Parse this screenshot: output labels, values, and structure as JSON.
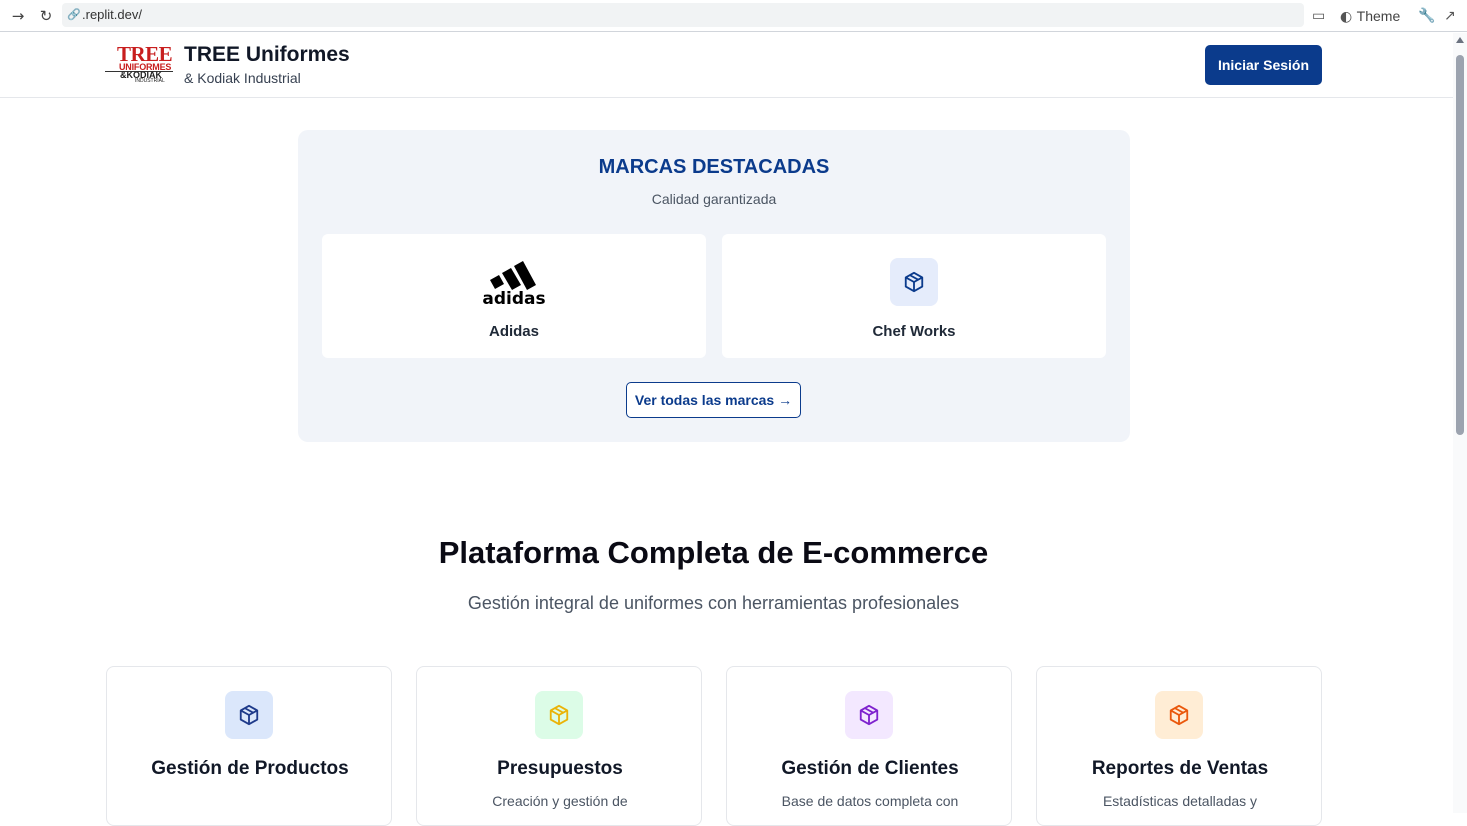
{
  "browser": {
    "url": ".replit.dev/",
    "theme_label": "Theme"
  },
  "header": {
    "logo": {
      "line1": "TREE",
      "line2": "UNIFORMES",
      "line3": "&KODIAK",
      "line4": "INDUSTRIAL"
    },
    "brand_name": "TREE Uniformes",
    "brand_sub": "& Kodiak Industrial",
    "login_label": "Iniciar Sesión"
  },
  "brands": {
    "title": "MARCAS DESTACADAS",
    "subtitle": "Calidad garantizada",
    "items": [
      {
        "name": "Adidas",
        "logo_text": "adidas"
      },
      {
        "name": "Chef Works"
      }
    ],
    "view_all_label": "Ver todas las marcas →"
  },
  "platform": {
    "title": "Plataforma Completa de E-commerce",
    "subtitle": "Gestión integral de uniformes con herramientas profesionales",
    "features": [
      {
        "title": "Gestión de Productos",
        "description": "",
        "icon": "box-icon",
        "color": "#1e3a8a",
        "bg": "#dbe7fb"
      },
      {
        "title": "Presupuestos",
        "description": "Creación y gestión de",
        "icon": "box-icon",
        "color": "#eab308",
        "bg": "#dcfce7"
      },
      {
        "title": "Gestión de Clientes",
        "description": "Base de datos completa con",
        "icon": "box-icon",
        "color": "#7e22ce",
        "bg": "#f3e8ff"
      },
      {
        "title": "Reportes de Ventas",
        "description": "Estadísticas detalladas y",
        "icon": "box-icon",
        "color": "#ea580c",
        "bg": "#ffedd5"
      }
    ]
  }
}
